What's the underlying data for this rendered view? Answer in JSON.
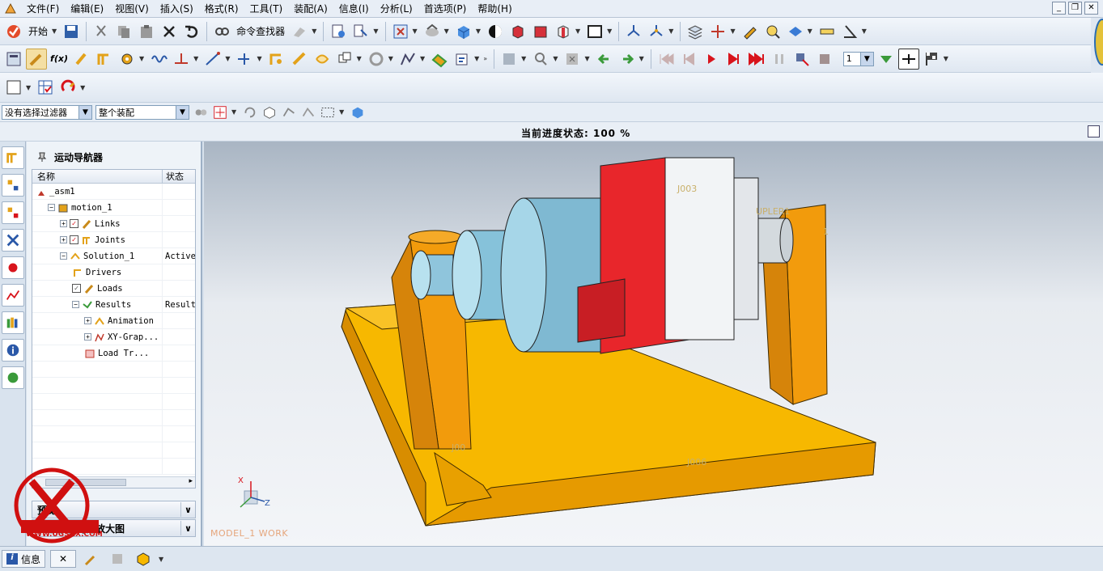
{
  "menubar": {
    "items": [
      "文件(F)",
      "编辑(E)",
      "视图(V)",
      "插入(S)",
      "格式(R)",
      "工具(T)",
      "装配(A)",
      "信息(I)",
      "分析(L)",
      "首选项(P)",
      "帮助(H)"
    ],
    "window_buttons": [
      "_",
      "❐",
      "✕"
    ]
  },
  "toolbar1": {
    "start_label": "开始",
    "command_finder_label": "命令查找器"
  },
  "filterbar": {
    "selection_filter": "没有选择过滤器",
    "scope": "整个装配"
  },
  "status": {
    "progress_text": "当前进度状态:  100 %"
  },
  "navigator": {
    "title": "运动导航器",
    "columns": [
      "名称",
      "状态"
    ],
    "rows": [
      {
        "name": "_asm1",
        "status": "",
        "icon": "assembly-icon",
        "indent": 0
      },
      {
        "name": "motion_1",
        "status": "",
        "icon": "motion-icon",
        "indent": 1
      },
      {
        "name": "Links",
        "status": "",
        "icon": "link-icon",
        "indent": 2,
        "checked": true
      },
      {
        "name": "Joints",
        "status": "",
        "icon": "joint-icon",
        "indent": 2,
        "checked": true
      },
      {
        "name": "Solution_1",
        "status": "Active",
        "icon": "solution-icon",
        "indent": 2
      },
      {
        "name": "Drivers",
        "status": "",
        "icon": "driver-icon",
        "indent": 3
      },
      {
        "name": "Loads",
        "status": "",
        "icon": "load-icon",
        "indent": 3,
        "checked": false
      },
      {
        "name": "Results",
        "status": "Result",
        "icon": "results-icon",
        "indent": 3
      },
      {
        "name": "Animation",
        "status": "",
        "icon": "animation-icon",
        "indent": 4
      },
      {
        "name": "XY-Grap...",
        "status": "",
        "icon": "xy-graph-icon",
        "indent": 4
      },
      {
        "name": "Load Tr...",
        "status": "",
        "icon": "load-transfer-icon",
        "indent": 4
      }
    ],
    "preview_label": "预览",
    "second_panel_label": "模态形状局部放大图"
  },
  "viewport": {
    "model_label": "MODEL_1 WORK",
    "joint_labels": [
      "J003",
      "UPLER1",
      "1",
      "J00",
      "J006"
    ],
    "triad": {
      "x": "X",
      "z": "Z"
    }
  },
  "bottom": {
    "info_tab": "信息",
    "close": "✕"
  },
  "watermark": {
    "text": "WWW.UGSNX.COM"
  },
  "colors": {
    "base": "#f7b800",
    "support": "#f29b0c",
    "shaft_blue": "#a9d8e8",
    "coupling_red": "#e8262b",
    "shaft_white": "#f2f4f6"
  }
}
